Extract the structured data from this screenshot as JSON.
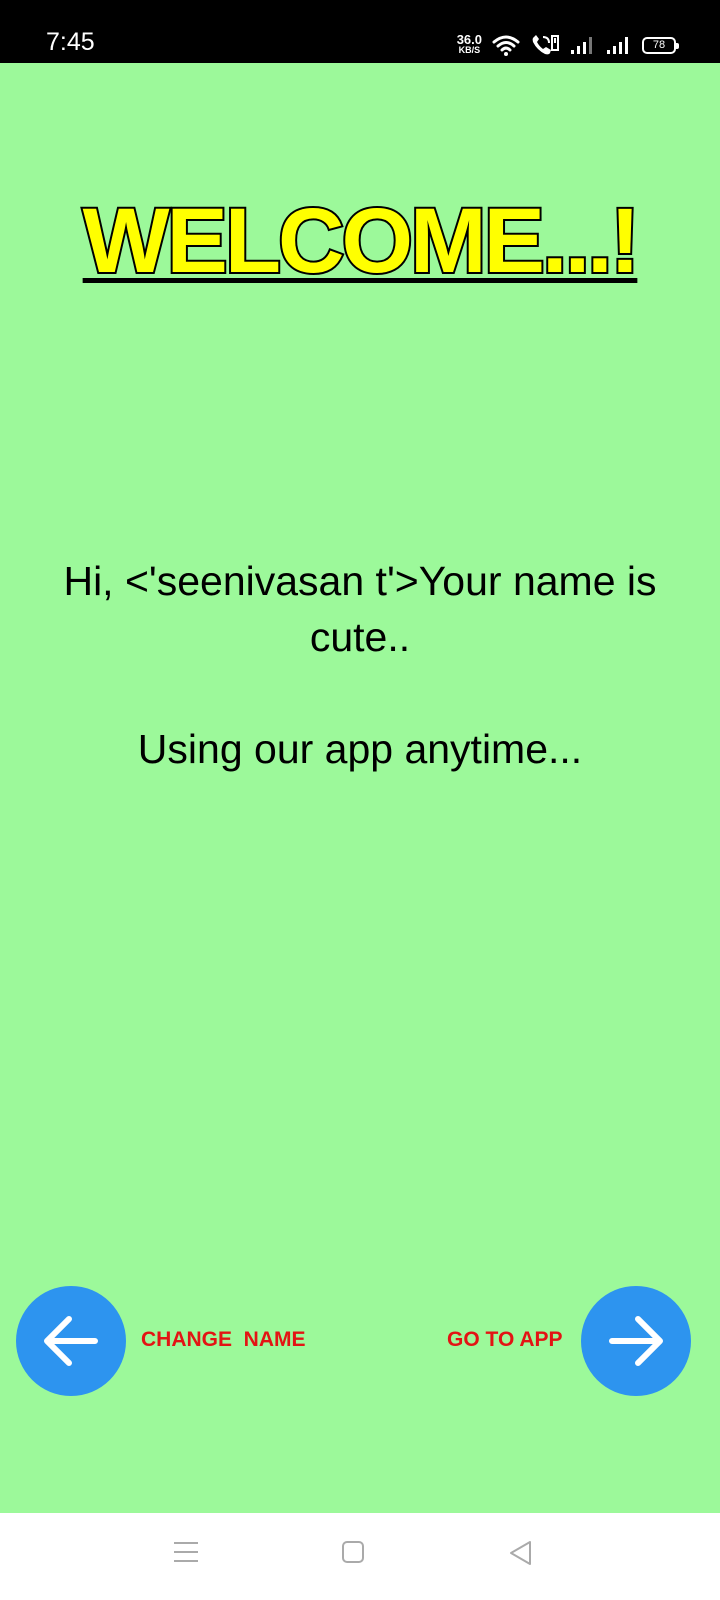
{
  "status_bar": {
    "time": "7:45",
    "net_speed_value": "36.0",
    "net_speed_unit": "KB/S",
    "battery": "78",
    "icons": [
      "wifi-icon",
      "volte-call-icon",
      "signal-1-icon",
      "signal-2-icon",
      "battery-icon"
    ]
  },
  "colors": {
    "background": "#9cf99a",
    "title_fill": "#ffff00",
    "title_stroke": "#000000",
    "fab": "#2d94ef",
    "fab_label": "#e31414"
  },
  "welcome": {
    "title": "WELCOME...!"
  },
  "message": {
    "line1": "Hi, <'seenivasan t'>Your name is cute..",
    "line2": "Using our app anytime..."
  },
  "actions": {
    "back_icon": "arrow-left-icon",
    "change_name_label": "CHANGE  NAME",
    "go_to_app_label": "GO TO APP",
    "forward_icon": "arrow-right-icon"
  },
  "nav_bar": {
    "icons": [
      "menu-icon",
      "home-icon",
      "back-icon"
    ]
  }
}
